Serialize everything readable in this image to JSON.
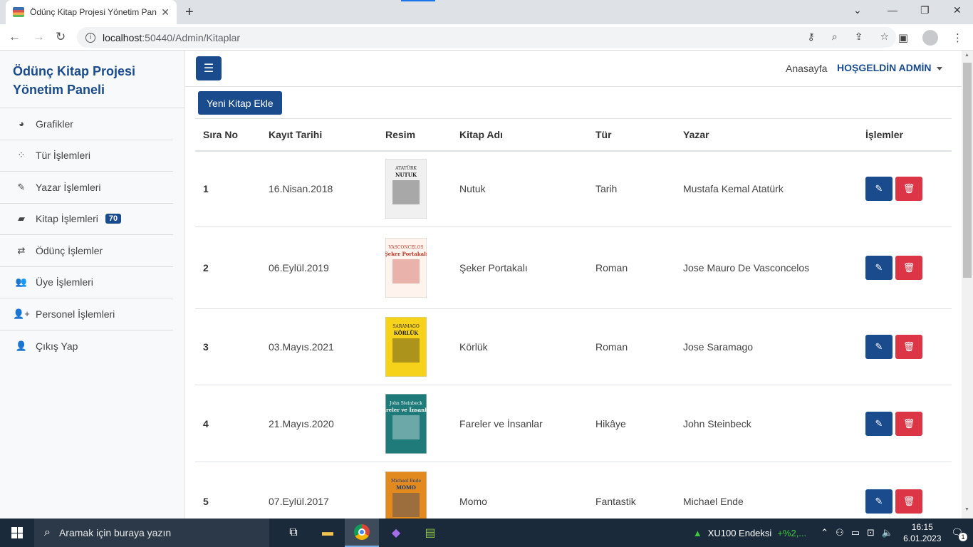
{
  "browser": {
    "tab_title": "Ödünç Kitap Projesi Yönetim Paneli",
    "url_host": "localhost",
    "url_path": ":50440/Admin/Kitaplar"
  },
  "sidebar": {
    "brand": "Ödünç Kitap Projesi Yönetim Paneli",
    "items": [
      {
        "label": "Grafikler",
        "icon": "pie-chart-icon"
      },
      {
        "label": "Tür İşlemleri",
        "icon": "spinner-icon"
      },
      {
        "label": "Yazar İşlemleri",
        "icon": "pencil-icon"
      },
      {
        "label": "Kitap İşlemleri",
        "icon": "book-icon",
        "badge": "70"
      },
      {
        "label": "Ödünç İşlemler",
        "icon": "exchange-icon"
      },
      {
        "label": "Üye İşlemleri",
        "icon": "users-icon"
      },
      {
        "label": "Personel İşlemleri",
        "icon": "user-plus-icon"
      },
      {
        "label": "Çıkış Yap",
        "icon": "user-icon"
      }
    ]
  },
  "topbar": {
    "home_label": "Anasayfa",
    "welcome_label": "HOŞGELDİN ADMİN"
  },
  "main": {
    "add_button": "Yeni Kitap Ekle",
    "columns": [
      "Sıra No",
      "Kayıt Tarihi",
      "Resim",
      "Kitap Adı",
      "Tür",
      "Yazar",
      "İşlemler"
    ],
    "rows": [
      {
        "no": "1",
        "date": "16.Nisan.2018",
        "title": "Nutuk",
        "genre": "Tarih",
        "author": "Mustafa Kemal Atatürk"
      },
      {
        "no": "2",
        "date": "06.Eylül.2019",
        "title": "Şeker Portakalı",
        "genre": "Roman",
        "author": "Jose Mauro De Vasconcelos"
      },
      {
        "no": "3",
        "date": "03.Mayıs.2021",
        "title": "Körlük",
        "genre": "Roman",
        "author": "Jose Saramago"
      },
      {
        "no": "4",
        "date": "21.Mayıs.2020",
        "title": "Fareler ve İnsanlar",
        "genre": "Hikâye",
        "author": "John Steinbeck"
      },
      {
        "no": "5",
        "date": "07.Eylül.2017",
        "title": "Momo",
        "genre": "Fantastik",
        "author": "Michael Ende"
      }
    ],
    "covers": [
      {
        "label": "NUTUK",
        "caption": "ATATÜRK",
        "bg": "#f0f0f0",
        "fg": "#222"
      },
      {
        "label": "Şeker Portakalı",
        "caption": "VASCONCELOS",
        "bg": "#fff3ee",
        "fg": "#c0392b"
      },
      {
        "label": "KÖRLÜK",
        "caption": "SARAMAGO",
        "bg": "#f6d21a",
        "fg": "#222"
      },
      {
        "label": "Fareler ve İnsanlar",
        "caption": "John Steinbeck",
        "bg": "#1f7a7a",
        "fg": "#fff"
      },
      {
        "label": "MOMO",
        "caption": "Michael Ende",
        "bg": "#e28a1d",
        "fg": "#1a3a7a"
      }
    ]
  },
  "taskbar": {
    "search_placeholder": "Aramak için buraya yazın",
    "stock_name": "XU100 Endeksi",
    "stock_change": "+%2,...",
    "time": "16:15",
    "date": "6.01.2023",
    "notifications": "1"
  },
  "colors": {
    "primary": "#1a4b8c",
    "danger": "#dc3545"
  }
}
